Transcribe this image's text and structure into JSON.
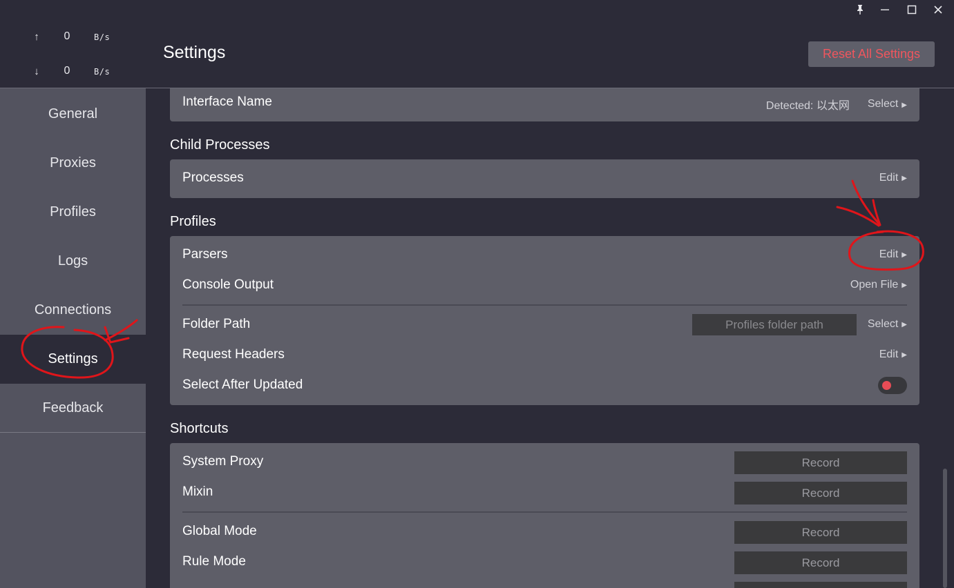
{
  "window": {
    "controls": [
      "pin-icon",
      "minimize-icon",
      "maximize-icon",
      "close-icon"
    ]
  },
  "traffic": {
    "up_arrow": "↑",
    "up_value": "0",
    "up_unit": "B/s",
    "down_arrow": "↓",
    "down_value": "0",
    "down_unit": "B/s"
  },
  "sidebar": {
    "items": [
      {
        "label": "General"
      },
      {
        "label": "Proxies"
      },
      {
        "label": "Profiles"
      },
      {
        "label": "Logs"
      },
      {
        "label": "Connections"
      },
      {
        "label": "Settings",
        "active": true
      },
      {
        "label": "Feedback"
      }
    ]
  },
  "header": {
    "title": "Settings",
    "reset_label": "Reset All Settings"
  },
  "sections": {
    "interface": {
      "label": "Interface Name",
      "detected": "Detected: 以太网",
      "action": "Select"
    },
    "child_processes": {
      "title": "Child Processes",
      "processes_label": "Processes",
      "processes_action": "Edit"
    },
    "profiles": {
      "title": "Profiles",
      "parsers_label": "Parsers",
      "parsers_action": "Edit",
      "console_label": "Console Output",
      "console_action": "Open File",
      "folder_label": "Folder Path",
      "folder_placeholder": "Profiles folder path",
      "folder_action": "Select",
      "headers_label": "Request Headers",
      "headers_action": "Edit",
      "select_after_label": "Select After Updated",
      "select_after_enabled": false
    },
    "shortcuts": {
      "title": "Shortcuts",
      "record_label": "Record",
      "items": [
        {
          "label": "System Proxy"
        },
        {
          "label": "Mixin"
        },
        {
          "label": "Global Mode"
        },
        {
          "label": "Rule Mode"
        }
      ]
    }
  },
  "colors": {
    "background": "#2c2b38",
    "sidebar": "#53535f",
    "card": "#5e5e68",
    "accent_red": "#f0565e",
    "annotation": "#e0151a"
  }
}
